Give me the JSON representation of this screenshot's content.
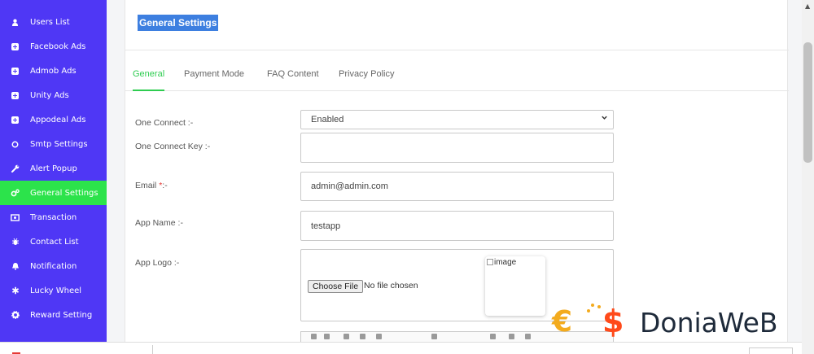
{
  "sidebar": {
    "items": [
      {
        "label": "Users List",
        "icon": "user-icon",
        "active": false
      },
      {
        "label": "Facebook Ads",
        "icon": "plus-square-icon",
        "active": false
      },
      {
        "label": "Admob Ads",
        "icon": "plus-square-icon",
        "active": false
      },
      {
        "label": "Unity Ads",
        "icon": "plus-square-icon",
        "active": false
      },
      {
        "label": "Appodeal Ads",
        "icon": "plus-square-icon",
        "active": false
      },
      {
        "label": "Smtp Settings",
        "icon": "circle-icon",
        "active": false
      },
      {
        "label": "Alert Popup",
        "icon": "wrench-icon",
        "active": false
      },
      {
        "label": "General Settings",
        "icon": "cogs-icon",
        "active": true
      },
      {
        "label": "Transaction",
        "icon": "money-icon",
        "active": false
      },
      {
        "label": "Contact List",
        "icon": "bug-icon",
        "active": false
      },
      {
        "label": "Notification",
        "icon": "bell-icon",
        "active": false
      },
      {
        "label": "Lucky Wheel",
        "icon": "asterisk-icon",
        "active": false
      },
      {
        "label": "Reward Setting",
        "icon": "gear-icon",
        "active": false
      }
    ]
  },
  "page": {
    "title": "General Settings"
  },
  "tabs": [
    {
      "label": "General",
      "active": true
    },
    {
      "label": "Payment Mode",
      "active": false
    },
    {
      "label": "FAQ Content",
      "active": false
    },
    {
      "label": "Privacy Policy",
      "active": false
    }
  ],
  "form": {
    "one_connect": {
      "label": "One Connect :-",
      "value": "Enabled"
    },
    "one_connect_key": {
      "label": "One Connect Key :-",
      "value": ""
    },
    "email": {
      "label": "Email ",
      "required_mark": "*",
      "label_suffix": ":-",
      "value": "admin@admin.com"
    },
    "app_name": {
      "label": "App Name :-",
      "value": "testapp"
    },
    "app_logo": {
      "label": "App Logo :-",
      "choose_button": "Choose File",
      "file_status": "No file chosen",
      "image_alt": "image"
    }
  },
  "watermark": {
    "text": "DoniaWeB"
  },
  "colors": {
    "sidebar_bg": "#4f37f5",
    "active_item_bg": "#2ce34b",
    "active_tab": "#2ecc50",
    "title_highlight": "#3d7fe0"
  }
}
